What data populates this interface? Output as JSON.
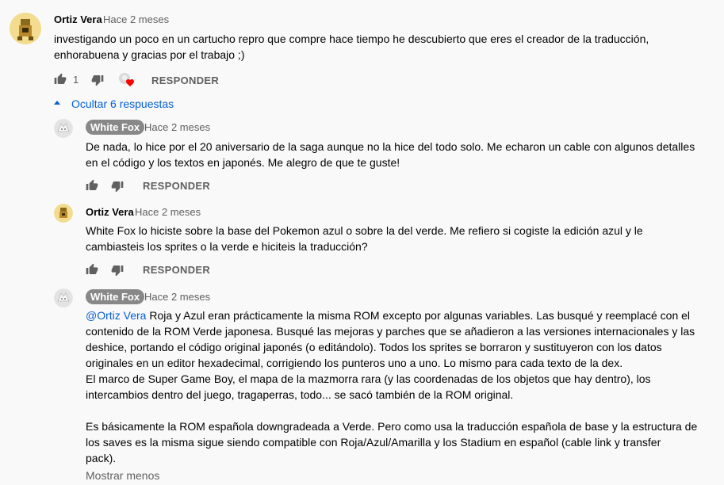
{
  "comments": [
    {
      "author": "Ortiz Vera",
      "time": "Hace 2 meses",
      "text": "investigando un poco en un cartucho repro que compre hace tiempo he descubierto que eres el creador de la traducción,\nenhorabuena y gracias por el trabajo ;)",
      "likes": "1",
      "reply_label": "RESPONDER"
    }
  ],
  "replies_toggle": "Ocultar 6 respuestas",
  "replies": [
    {
      "author": "White Fox",
      "time": "Hace 2 meses",
      "text": "De nada, lo hice por el 20 aniversario de la saga aunque no la hice del todo solo. Me echaron un cable con algunos detalles\nen el código y los textos en japonés. Me alegro de que te guste!",
      "reply_label": "RESPONDER"
    },
    {
      "author": "Ortiz Vera",
      "time": "Hace 2 meses",
      "text": "White Fox lo hiciste sobre la base del Pokemon azul o sobre la del verde. Me refiero si cogiste la edición azul y le\ncambiasteis los sprites o la verde e hiciteis la traducción?",
      "reply_label": "RESPONDER"
    },
    {
      "author": "White Fox",
      "time": "Hace 2 meses",
      "mention": "@Ortiz Vera",
      "text": " Roja y Azul eran prácticamente la misma ROM excepto por algunas variables. Las busqué y reemplacé con el\ncontenido de la ROM Verde japonesa. Busqué las mejoras y parches que se añadieron a las versiones internacionales y las\ndeshice, portando el código original japonés (o editándolo). Todos los sprites se borraron y sustituyeron con los datos\noriginales en un editor hexadecimal, corrigiendo los punteros uno a uno. Lo mismo para cada texto de la dex.\nEl marco de Super Game Boy, el mapa de la mazmorra rara (y las coordenadas de los objetos que hay dentro), los\nintercambios dentro del juego, tragaperras, todo... se sacó también de la ROM original.\n\nEs básicamente la ROM española downgradeada a Verde. Pero como usa la traducción española de base y la estructura de\nlos saves es la misma sigue siendo compatible con Roja/Azul/Amarilla y los Stadium en español (cable link y transfer\npack).",
      "show_less": "Mostrar menos"
    }
  ],
  "colors": {
    "link": "#065fd4",
    "badge": "#888888",
    "heart": "#ff0000"
  },
  "icons": [
    "thumb-up-icon",
    "thumb-down-icon",
    "creator-heart-icon",
    "chevron-up-icon"
  ]
}
